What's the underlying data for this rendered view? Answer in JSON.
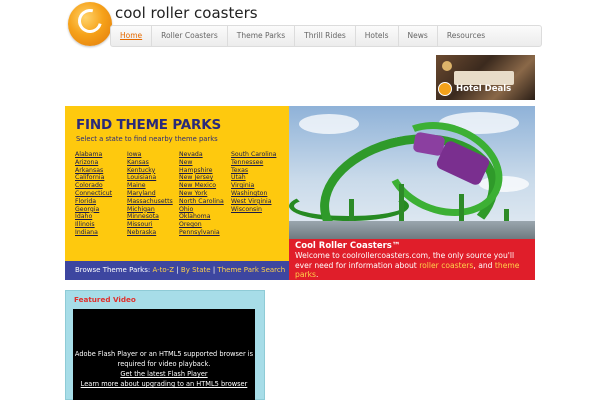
{
  "site": {
    "title": "cool roller coasters"
  },
  "nav": {
    "items": [
      {
        "label": "Home",
        "active": true
      },
      {
        "label": "Roller Coasters",
        "active": false
      },
      {
        "label": "Theme Parks",
        "active": false
      },
      {
        "label": "Thrill Rides",
        "active": false
      },
      {
        "label": "Hotels",
        "active": false
      },
      {
        "label": "News",
        "active": false
      },
      {
        "label": "Resources",
        "active": false
      }
    ]
  },
  "hotel_banner": {
    "label": "Hotel Deals"
  },
  "parks": {
    "title": "FIND THEME PARKS",
    "subtitle": "Select a state to find nearby theme parks",
    "columns": [
      [
        "Alabama",
        "Arizona",
        "Arkansas",
        "California",
        "Colorado",
        "Connecticut",
        "Florida",
        "Georgia",
        "Idaho",
        "Illinois",
        "Indiana"
      ],
      [
        "Iowa",
        "Kansas",
        "Kentucky",
        "Louisiana",
        "Maine",
        "Maryland",
        "Massachusetts",
        "Michigan",
        "Minnesota",
        "Missouri",
        "Nebraska"
      ],
      [
        "Nevada",
        "New",
        "Hampshire",
        "New Jersey",
        "New Mexico",
        "New York",
        "North Carolina",
        "Ohio",
        "Oklahoma",
        "Oregon",
        "Pennsylvania"
      ],
      [
        "South Carolina",
        "Tennessee",
        "Texas",
        "Utah",
        "Virginia",
        "Washington",
        "West Virginia",
        "Wisconsin"
      ]
    ]
  },
  "browse": {
    "prefix": "Browse Theme Parks:",
    "az": "A-to-Z",
    "sep1": " | ",
    "by_state": "By State",
    "sep2": " | ",
    "search": "Theme Park Search"
  },
  "promo": {
    "title": "Cool Roller Coasters™",
    "text_before": "Welcome to coolrollercoasters.com, the only source you'll ever need for information about ",
    "link1": "roller coasters",
    "text_mid": ", and ",
    "link2": "theme parks",
    "text_after": "."
  },
  "video": {
    "title": "Featured Video",
    "message": "Adobe Flash Player or an HTML5 supported browser is required for video playback.",
    "link1": "Get the latest Flash Player",
    "link2": "Learn more about upgrading to an HTML5 browser"
  },
  "colors": {
    "accent": "#fec90e",
    "nav_active": "#e56a00",
    "browse_bar": "#3d46a0",
    "promo_bg": "#e01e2a",
    "video_bg": "#a7dde8"
  }
}
